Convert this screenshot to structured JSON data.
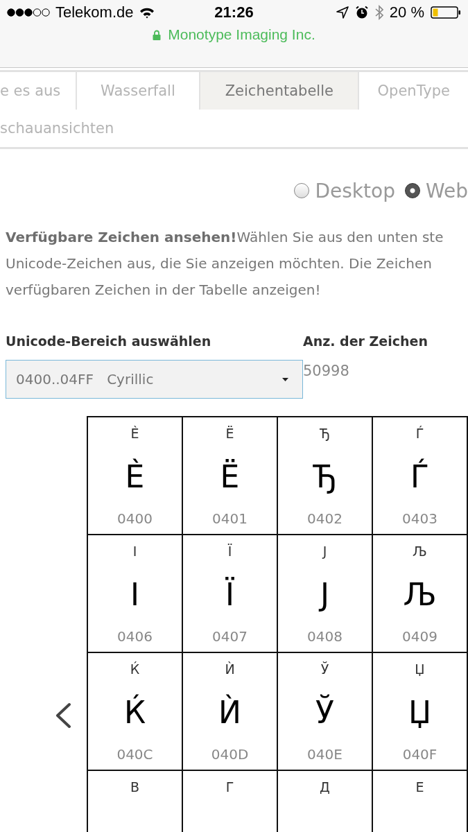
{
  "status_bar": {
    "carrier": "Telekom.de",
    "time": "21:26",
    "battery": "20 %"
  },
  "url_bar": {
    "text": "Monotype Imaging Inc."
  },
  "tab_rows": [
    {
      "tabs": [
        {
          "label": "e es aus",
          "selected": false
        },
        {
          "label": "Wasserfall",
          "selected": false
        },
        {
          "label": "Zeichentabelle",
          "selected": true
        },
        {
          "label": "OpenType",
          "selected": false
        }
      ]
    },
    {
      "tabs": [
        {
          "label": "schauansichten",
          "selected": false
        }
      ]
    }
  ],
  "radios": [
    {
      "label": "Desktop",
      "selected": false
    },
    {
      "label": "Web",
      "selected": true
    }
  ],
  "intro": "**Verfügbare Zeichen ansehen!**Wählen Sie aus den unten ste\nUnicode-Zeichen aus, die Sie anzeigen möchten. Die Zeichen\nverfügbaren Zeichen in der Tabelle anzeigen!",
  "range_label": "Unicode-Bereich auswählen",
  "range_select": {
    "value": "0400..04FF   Cyrillic"
  },
  "count_label": "Anz. der Zeichen",
  "count": "50998",
  "grid": [
    {
      "cells": [
        {
          "preview": "Ѐ",
          "glyph": "Ѐ",
          "code": "0400"
        },
        {
          "preview": "Ё",
          "glyph": "Ё",
          "code": "0401"
        },
        {
          "preview": "Ђ",
          "glyph": "Ђ",
          "code": "0402"
        },
        {
          "preview": "Ѓ",
          "glyph": "Ѓ",
          "code": "0403"
        }
      ]
    },
    {
      "cells": [
        {
          "preview": "І",
          "glyph": "І",
          "code": "0406"
        },
        {
          "preview": "Ї",
          "glyph": "Ї",
          "code": "0407"
        },
        {
          "preview": "Ј",
          "glyph": "Ј",
          "code": "0408"
        },
        {
          "preview": "Љ",
          "glyph": "Љ",
          "code": "0409"
        }
      ]
    },
    {
      "cells": [
        {
          "preview": "Ќ",
          "glyph": "Ќ",
          "code": "040C"
        },
        {
          "preview": "Ѝ",
          "glyph": "Ѝ",
          "code": "040D"
        },
        {
          "preview": "Ў",
          "glyph": "Ў",
          "code": "040E"
        },
        {
          "preview": "Џ",
          "glyph": "Џ",
          "code": "040F"
        }
      ]
    },
    {
      "cells": [
        {
          "preview": "В"
        },
        {
          "preview": "Г"
        },
        {
          "preview": "Д"
        },
        {
          "preview": "Е"
        }
      ]
    }
  ]
}
